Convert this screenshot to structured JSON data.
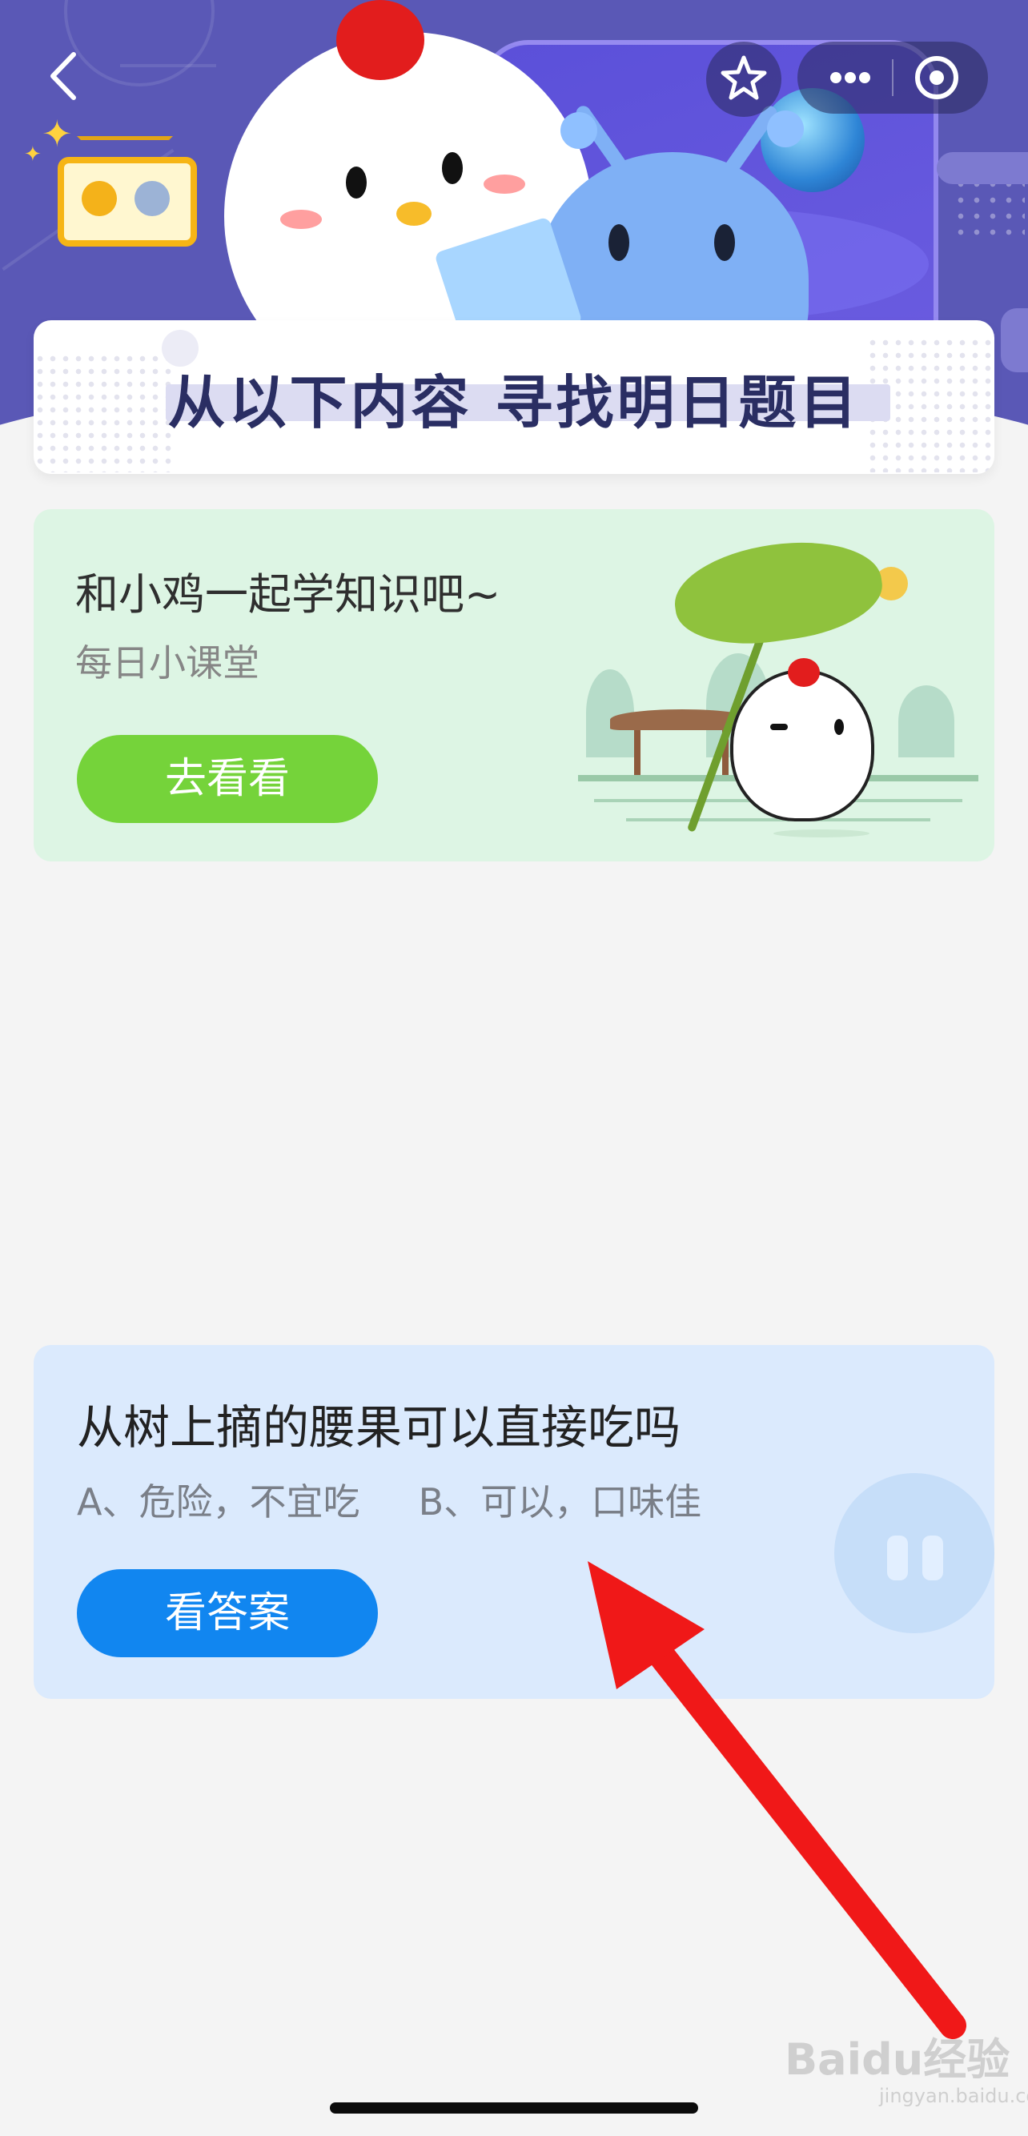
{
  "header": {
    "title": "从以下内容  寻找明日题目",
    "icons": {
      "back": "chevron-left-icon",
      "favorite": "star-icon",
      "more": "more-dots-icon",
      "close": "target-circle-icon"
    }
  },
  "learn_card": {
    "title": "和小鸡一起学知识吧~",
    "subtitle": "每日小课堂",
    "button_label": "去看看",
    "button_color": "#75d33a",
    "background": "#ddf5e4"
  },
  "question_card": {
    "question": "从树上摘的腰果可以直接吃吗",
    "option_a": "A、危险，不宜吃",
    "option_b": "B、可以，口味佳",
    "button_label": "看答案",
    "button_color": "#1186f0",
    "background": "#dbeafd"
  },
  "annotation": {
    "arrow_color": "#f01818"
  },
  "watermark": {
    "brand": "Baidu经验",
    "domain": "jingyan.baidu.com"
  },
  "colors": {
    "header_bg": "#5a58b6",
    "page_bg": "#f4f4f4",
    "title_text": "#2a2e63"
  }
}
